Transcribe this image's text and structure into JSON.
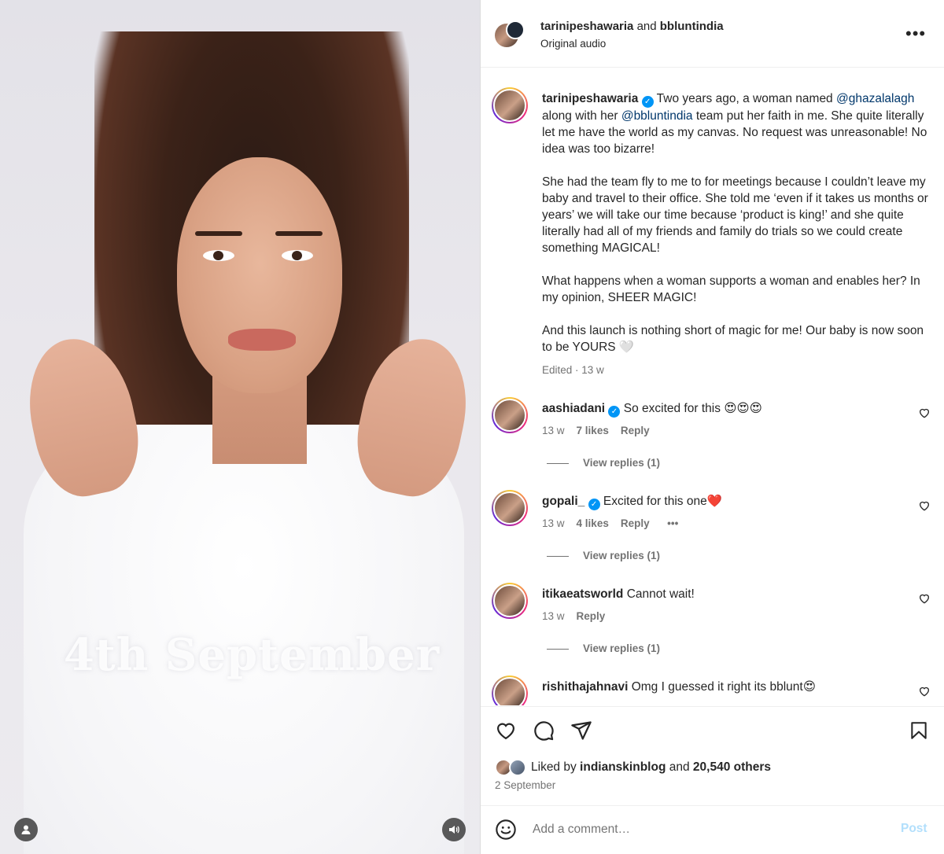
{
  "header": {
    "author": "tarinipeshawaria",
    "joiner": "and",
    "coauthor": "bbluntindia",
    "audio": "Original audio",
    "more_icon": "more-horizontal-icon"
  },
  "media": {
    "caption_overlay": "4th September",
    "profile_tag_icon": "user-tag-icon",
    "sound_icon": "speaker-icon"
  },
  "caption": {
    "username": "tarinipeshawaria",
    "p1_a": "Two years ago, a woman named",
    "mention1": "@ghazalalagh",
    "p1_b": "along with her",
    "mention2": "@bbluntindia",
    "p1_c": "team put her faith in me. She quite literally let me have the world as my canvas. No request was unreasonable! No idea was too bizarre!",
    "p2": "She had the team fly to me to for meetings because I couldn’t leave my baby and travel to their office. She told me ‘even if it takes us months or years’ we will take our time because ‘product is king!’ and she quite literally had all of my friends and family do trials so we could create something MAGICAL!",
    "p3": "What happens when a woman supports a woman and enables her? In my opinion, SHEER MAGIC!",
    "p4": "And this launch is nothing short of magic for me! Our baby is now soon to be YOURS 🤍",
    "edited": "Edited · 13 w"
  },
  "comments": [
    {
      "username": "aashiadani",
      "verified": true,
      "text": "So excited for this 😍😍😍",
      "age": "13 w",
      "likes": "7 likes",
      "reply": "Reply",
      "view_replies": "View replies (1)"
    },
    {
      "username": "gopali_",
      "verified": true,
      "text": "Excited for this one❤️",
      "age": "13 w",
      "likes": "4 likes",
      "reply": "Reply",
      "more": "•••",
      "view_replies": "View replies (1)"
    },
    {
      "username": "itikaeatsworld",
      "verified": false,
      "text": "Cannot wait!",
      "age": "13 w",
      "reply": "Reply",
      "view_replies": "View replies (1)"
    },
    {
      "username": "rishithajahnavi",
      "verified": false,
      "text": "Omg I guessed it right its bblunt😍"
    }
  ],
  "actions": {
    "liked_prefix": "Liked by",
    "liked_user": "indianskinblog",
    "liked_and": "and",
    "liked_others": "20,540 others",
    "date": "2 September"
  },
  "composer": {
    "placeholder": "Add a comment…",
    "post_label": "Post"
  },
  "colors": {
    "link": "#00376b",
    "verified": "#0095f6",
    "post_disabled": "#b2dffc",
    "muted": "#737373"
  }
}
